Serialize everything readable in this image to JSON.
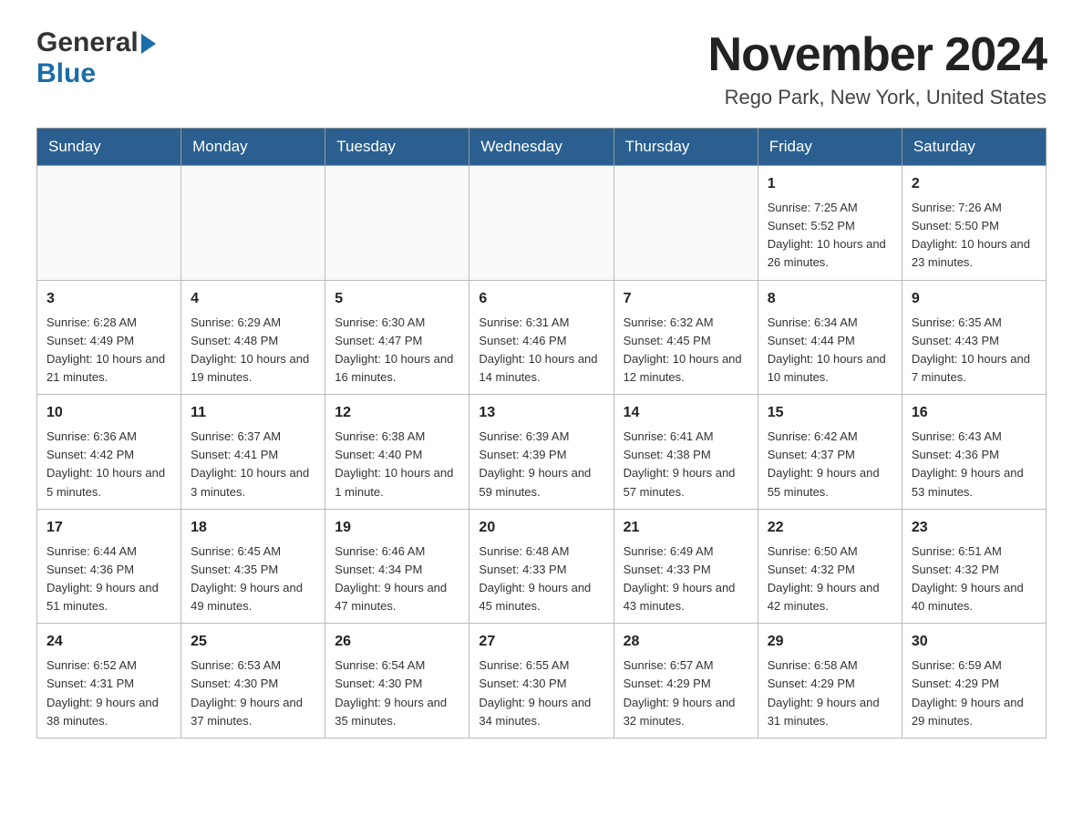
{
  "header": {
    "title": "November 2024",
    "location": "Rego Park, New York, United States",
    "logo_general": "General",
    "logo_blue": "Blue"
  },
  "weekdays": [
    "Sunday",
    "Monday",
    "Tuesday",
    "Wednesday",
    "Thursday",
    "Friday",
    "Saturday"
  ],
  "weeks": [
    [
      {
        "day": "",
        "info": ""
      },
      {
        "day": "",
        "info": ""
      },
      {
        "day": "",
        "info": ""
      },
      {
        "day": "",
        "info": ""
      },
      {
        "day": "",
        "info": ""
      },
      {
        "day": "1",
        "info": "Sunrise: 7:25 AM\nSunset: 5:52 PM\nDaylight: 10 hours and 26 minutes."
      },
      {
        "day": "2",
        "info": "Sunrise: 7:26 AM\nSunset: 5:50 PM\nDaylight: 10 hours and 23 minutes."
      }
    ],
    [
      {
        "day": "3",
        "info": "Sunrise: 6:28 AM\nSunset: 4:49 PM\nDaylight: 10 hours and 21 minutes."
      },
      {
        "day": "4",
        "info": "Sunrise: 6:29 AM\nSunset: 4:48 PM\nDaylight: 10 hours and 19 minutes."
      },
      {
        "day": "5",
        "info": "Sunrise: 6:30 AM\nSunset: 4:47 PM\nDaylight: 10 hours and 16 minutes."
      },
      {
        "day": "6",
        "info": "Sunrise: 6:31 AM\nSunset: 4:46 PM\nDaylight: 10 hours and 14 minutes."
      },
      {
        "day": "7",
        "info": "Sunrise: 6:32 AM\nSunset: 4:45 PM\nDaylight: 10 hours and 12 minutes."
      },
      {
        "day": "8",
        "info": "Sunrise: 6:34 AM\nSunset: 4:44 PM\nDaylight: 10 hours and 10 minutes."
      },
      {
        "day": "9",
        "info": "Sunrise: 6:35 AM\nSunset: 4:43 PM\nDaylight: 10 hours and 7 minutes."
      }
    ],
    [
      {
        "day": "10",
        "info": "Sunrise: 6:36 AM\nSunset: 4:42 PM\nDaylight: 10 hours and 5 minutes."
      },
      {
        "day": "11",
        "info": "Sunrise: 6:37 AM\nSunset: 4:41 PM\nDaylight: 10 hours and 3 minutes."
      },
      {
        "day": "12",
        "info": "Sunrise: 6:38 AM\nSunset: 4:40 PM\nDaylight: 10 hours and 1 minute."
      },
      {
        "day": "13",
        "info": "Sunrise: 6:39 AM\nSunset: 4:39 PM\nDaylight: 9 hours and 59 minutes."
      },
      {
        "day": "14",
        "info": "Sunrise: 6:41 AM\nSunset: 4:38 PM\nDaylight: 9 hours and 57 minutes."
      },
      {
        "day": "15",
        "info": "Sunrise: 6:42 AM\nSunset: 4:37 PM\nDaylight: 9 hours and 55 minutes."
      },
      {
        "day": "16",
        "info": "Sunrise: 6:43 AM\nSunset: 4:36 PM\nDaylight: 9 hours and 53 minutes."
      }
    ],
    [
      {
        "day": "17",
        "info": "Sunrise: 6:44 AM\nSunset: 4:36 PM\nDaylight: 9 hours and 51 minutes."
      },
      {
        "day": "18",
        "info": "Sunrise: 6:45 AM\nSunset: 4:35 PM\nDaylight: 9 hours and 49 minutes."
      },
      {
        "day": "19",
        "info": "Sunrise: 6:46 AM\nSunset: 4:34 PM\nDaylight: 9 hours and 47 minutes."
      },
      {
        "day": "20",
        "info": "Sunrise: 6:48 AM\nSunset: 4:33 PM\nDaylight: 9 hours and 45 minutes."
      },
      {
        "day": "21",
        "info": "Sunrise: 6:49 AM\nSunset: 4:33 PM\nDaylight: 9 hours and 43 minutes."
      },
      {
        "day": "22",
        "info": "Sunrise: 6:50 AM\nSunset: 4:32 PM\nDaylight: 9 hours and 42 minutes."
      },
      {
        "day": "23",
        "info": "Sunrise: 6:51 AM\nSunset: 4:32 PM\nDaylight: 9 hours and 40 minutes."
      }
    ],
    [
      {
        "day": "24",
        "info": "Sunrise: 6:52 AM\nSunset: 4:31 PM\nDaylight: 9 hours and 38 minutes."
      },
      {
        "day": "25",
        "info": "Sunrise: 6:53 AM\nSunset: 4:30 PM\nDaylight: 9 hours and 37 minutes."
      },
      {
        "day": "26",
        "info": "Sunrise: 6:54 AM\nSunset: 4:30 PM\nDaylight: 9 hours and 35 minutes."
      },
      {
        "day": "27",
        "info": "Sunrise: 6:55 AM\nSunset: 4:30 PM\nDaylight: 9 hours and 34 minutes."
      },
      {
        "day": "28",
        "info": "Sunrise: 6:57 AM\nSunset: 4:29 PM\nDaylight: 9 hours and 32 minutes."
      },
      {
        "day": "29",
        "info": "Sunrise: 6:58 AM\nSunset: 4:29 PM\nDaylight: 9 hours and 31 minutes."
      },
      {
        "day": "30",
        "info": "Sunrise: 6:59 AM\nSunset: 4:29 PM\nDaylight: 9 hours and 29 minutes."
      }
    ]
  ]
}
